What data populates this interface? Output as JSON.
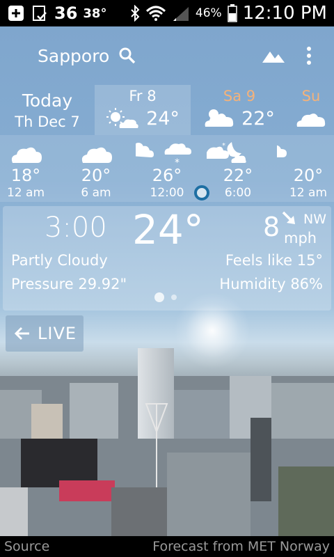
{
  "status_bar": {
    "temp1": "36",
    "temp2": "38°",
    "battery": "46%",
    "time": "12:10 PM"
  },
  "header": {
    "city": "Sapporo",
    "icons": [
      "search-icon",
      "landscape-icon",
      "more-vert-icon"
    ]
  },
  "days": [
    {
      "line1": "Today",
      "line2": "Th Dec 7"
    },
    {
      "label": "Fr 8",
      "temp": "24°",
      "icon": "sun-cloud-icon",
      "selected": true
    },
    {
      "label": "Sa 9",
      "temp": "22°",
      "icon": "cloud-icon",
      "weekend": true
    },
    {
      "label": "Su",
      "icon": "cloud-icon",
      "weekend": true
    }
  ],
  "hourly": [
    {
      "temp": "18°",
      "time": "12 am",
      "icon": "cloud-icon"
    },
    {
      "temp": "20°",
      "time": "6 am",
      "icon": "cloud-icon"
    },
    {
      "temp": "26°",
      "time": "12:00",
      "icon": "sun-cloud-snow-icon"
    },
    {
      "temp": "22°",
      "time": "6:00",
      "icon": "moon-cloud-icon"
    },
    {
      "temp": "20°",
      "time": "12 am",
      "icon": "cloud-snow-icon"
    }
  ],
  "detail": {
    "time": "3:00",
    "temp": "24°",
    "wind_speed": "8",
    "wind_dir": "NW",
    "wind_unit": "mph",
    "condition": "Partly Cloudy",
    "pressure": "Pressure 29.92\"",
    "feels_like": "Feels like 15°",
    "humidity": "Humidity 86%"
  },
  "live": {
    "label": "LIVE"
  },
  "footer": {
    "source": "Source",
    "forecast": "Forecast from MET Norway"
  },
  "colors": {
    "weekend": "#f4b27a",
    "now_dot": "#1e6fa3"
  }
}
